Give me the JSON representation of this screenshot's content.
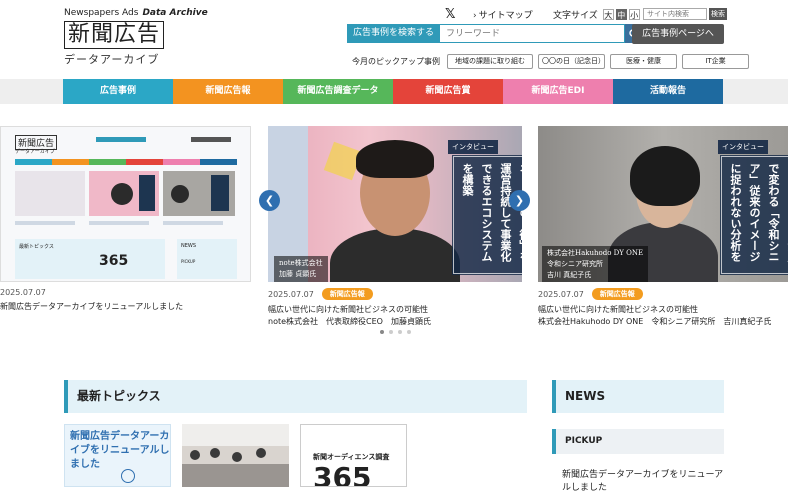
{
  "header": {
    "logo_top": "Newspapers Ads",
    "logo_top_em": "Data Archive",
    "logo_main": "新聞広告",
    "logo_sub": "データアーカイブ",
    "x_glyph": "𝕏",
    "sitemap": "サイトマップ",
    "fontsize_label": "文字サイズ",
    "fontsize_options": [
      "大",
      "中",
      "小"
    ],
    "site_search_placeholder": "サイト内検索",
    "site_search_button": "検索",
    "ad_search_label": "広告事例を検索する",
    "ad_search_placeholder": "フリーワード",
    "ad_page_button": "広告事例ページへ",
    "pickup_label": "今月のピックアップ事例",
    "pickup_items": [
      "地域の課題に取り組む",
      "〇〇の日（記念日）",
      "医療・健康",
      "IT企業"
    ]
  },
  "nav": {
    "items": [
      {
        "label": "広告事例",
        "color": "#2ba7c6"
      },
      {
        "label": "新聞広告報",
        "color": "#f39320"
      },
      {
        "label": "新聞広告調査データ",
        "color": "#56b75a"
      },
      {
        "label": "新聞広告賞",
        "color": "#e4443a"
      },
      {
        "label": "新聞広告EDI",
        "color": "#ee7fae"
      },
      {
        "label": "活動報告",
        "color": "#1e6aa0"
      }
    ]
  },
  "carousel": {
    "slides": [
      {
        "date": "2025.07.07",
        "caption": "新聞広告データアーカイブをリニューアルしました"
      },
      {
        "tag": "インタビュー",
        "title": "多様な人々が集まるネット上の「街」を運営持続して事業化できるエコシステムを構築",
        "company": "note株式会社",
        "person": "加藤 貞顕氏",
        "date": "2025.07.07",
        "category": "新聞広告報",
        "caption_line1": "幅広い世代に向けた新聞社ビジネスの可能性",
        "caption_line2": "note株式会社　代表取締役CEO　加藤貞顕氏"
      },
      {
        "tag": "インタビュー",
        "title": "スマートフォン活用で変わる「令和シニア」従来のイメージに捉われない分析を",
        "company": "株式会社Hakuhodo DY ONE",
        "dept": "令和シニア研究所",
        "person": "吉川 真紀子氏",
        "date": "2025.07.07",
        "category": "新聞広告報",
        "caption_line1": "幅広い世代に向けた新聞社ビジネスの可能性",
        "caption_line2": "株式会社Hakuhodo DY ONE　令和シニア研究所　吉川真紀子氏"
      }
    ],
    "prev": "❮",
    "next": "❯"
  },
  "mini": {
    "logo": "新聞広告",
    "sub": "データアーカイブ",
    "topics": "最新トピックス",
    "news": "NEWS",
    "pickup": "PICKUP",
    "n365": "365"
  },
  "topics": {
    "heading": "最新トピックス",
    "card1_text": "新聞広告データアーカイブをリニューアルしました",
    "card3_label": "新聞オーディエンス調査",
    "card3_big": "365"
  },
  "news": {
    "heading": "NEWS",
    "pickup_heading": "PICKUP",
    "pickup_text": "新聞広告データアーカイブをリニューアルしました"
  }
}
